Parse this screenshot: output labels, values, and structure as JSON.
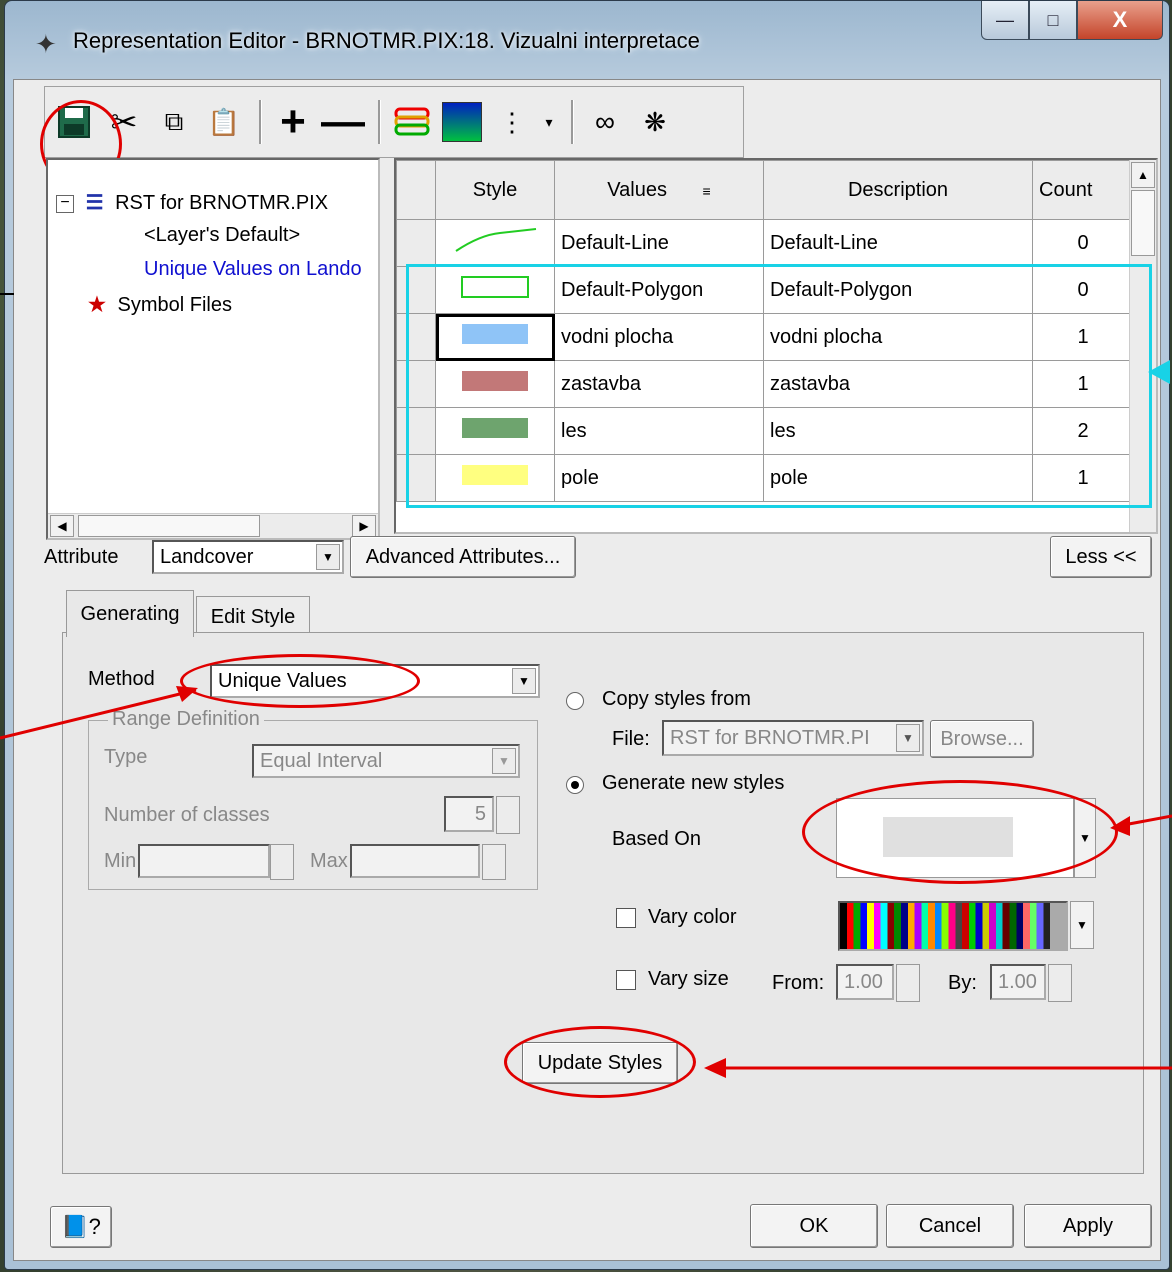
{
  "window": {
    "title": "Representation Editor - BRNOTMR.PIX:18. Vizualni interpretace"
  },
  "toolbar": {
    "icons": [
      "save-icon",
      "cut-icon",
      "copy-icon",
      "paste-icon",
      "plus-icon",
      "minus-icon",
      "style-icon",
      "gradient-icon",
      "options-icon",
      "link-icon",
      "unlink-icon"
    ]
  },
  "tree": {
    "root": "RST for BRNOTMR.PIX",
    "child1": "<Layer's Default>",
    "child2": "Unique Values on Lando",
    "symbol": "Symbol Files"
  },
  "grid": {
    "headers": {
      "style": "Style",
      "values": "Values",
      "description": "Description",
      "count": "Count"
    },
    "rows": [
      {
        "value": "Default-Line",
        "description": "Default-Line",
        "count": "0",
        "color": "#22cc22",
        "kind": "line"
      },
      {
        "value": "Default-Polygon",
        "description": "Default-Polygon",
        "count": "0",
        "color": "#22cc22",
        "kind": "outline"
      },
      {
        "value": "vodni plocha",
        "description": "vodni plocha",
        "count": "1",
        "color": "#8fc4f7",
        "kind": "fill"
      },
      {
        "value": "zastavba",
        "description": "zastavba",
        "count": "1",
        "color": "#c27878",
        "kind": "fill"
      },
      {
        "value": "les",
        "description": "les",
        "count": "2",
        "color": "#6ea46e",
        "kind": "fill"
      },
      {
        "value": "pole",
        "description": "pole",
        "count": "1",
        "color": "#ffff80",
        "kind": "fill"
      }
    ]
  },
  "attribute": {
    "label": "Attribute",
    "value": "Landcover",
    "advanced": "Advanced Attributes...",
    "less": "Less <<"
  },
  "tabs": {
    "generating": "Generating",
    "edit_style": "Edit Style"
  },
  "method": {
    "label": "Method",
    "value": "Unique Values"
  },
  "range": {
    "title": "Range Definition",
    "type_label": "Type",
    "type_value": "Equal Interval",
    "classes_label": "Number of classes",
    "classes_value": "5",
    "min_label": "Min",
    "max_label": "Max"
  },
  "copy": {
    "label": "Copy styles from",
    "file_label": "File:",
    "file_value": "RST for BRNOTMR.PI",
    "browse": "Browse..."
  },
  "generate": {
    "label": "Generate new styles",
    "based_on": "Based On"
  },
  "vary": {
    "color_label": "Vary color",
    "size_label": "Vary size",
    "from_label": "From:",
    "from_value": "1.00",
    "by_label": "By:",
    "by_value": "1.00"
  },
  "update_button": "Update Styles",
  "footer": {
    "ok": "OK",
    "cancel": "Cancel",
    "apply": "Apply",
    "help_icon": "help-book-icon"
  }
}
